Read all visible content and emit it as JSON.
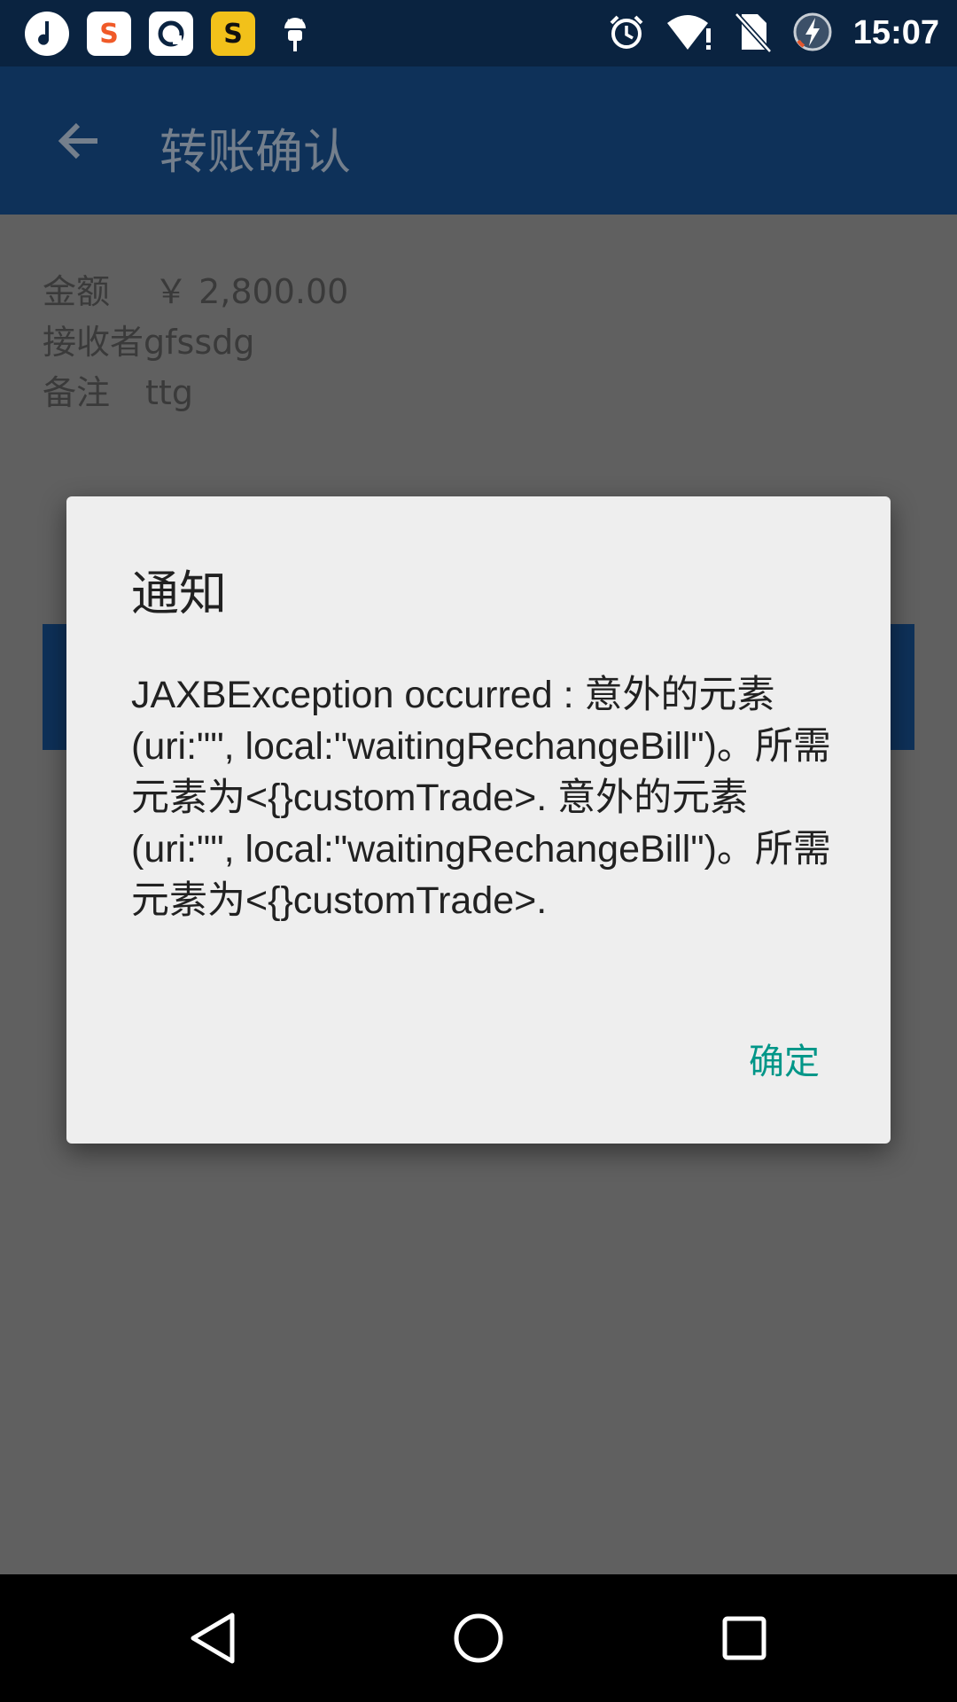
{
  "status_bar": {
    "time": "15:07",
    "notification_icons": [
      "music-app-icon",
      "sogou-input-icon",
      "browser-app-icon",
      "game-app-icon",
      "android-debug-icon"
    ],
    "system_icons": [
      "alarm-icon",
      "wifi-icon",
      "no-sim-icon",
      "battery-charging-icon"
    ]
  },
  "toolbar": {
    "title": "转账确认",
    "back_icon": "arrow-back-icon"
  },
  "transfer": {
    "amount_label": "金额",
    "amount_value": "￥ 2,800.00",
    "receiver_label": "接收者",
    "receiver_value": "gfssdg",
    "note_label": "备注",
    "note_value": "ttg",
    "confirm_label": "确定"
  },
  "dialog": {
    "title": "通知",
    "message": "JAXBException occurred : 意外的元素 (uri:\"\", local:\"waitingRechangeBill\")。所需元素为<{}customTrade>. 意外的元素 (uri:\"\", local:\"waitingRechangeBill\")。所需元素为<{}customTrade>.",
    "ok_label": "确定"
  },
  "colors": {
    "status_bar": "#0a2340",
    "toolbar": "#0e3159",
    "dialog_accent": "#009688"
  }
}
